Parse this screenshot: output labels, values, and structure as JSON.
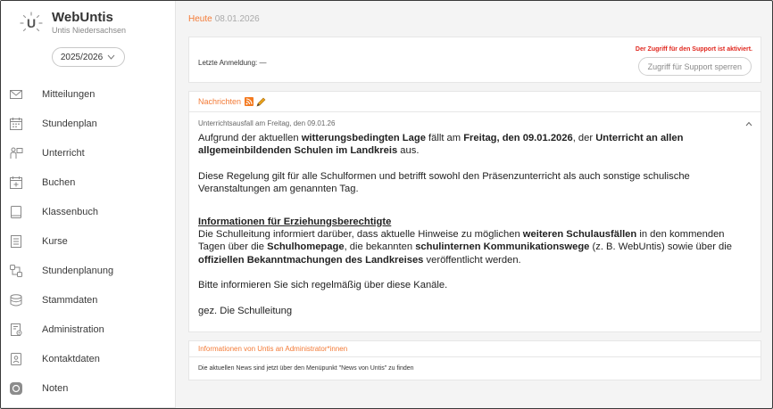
{
  "brand": {
    "title": "WebUntis",
    "subtitle": "Untis Niedersachsen"
  },
  "school_year": {
    "selected": "2025/2026"
  },
  "sidebar": {
    "items": [
      {
        "label": "Mitteilungen",
        "icon": "mail-icon"
      },
      {
        "label": "Stundenplan",
        "icon": "calendar-icon"
      },
      {
        "label": "Unterricht",
        "icon": "teacher-icon"
      },
      {
        "label": "Buchen",
        "icon": "calendar-plus-icon"
      },
      {
        "label": "Klassenbuch",
        "icon": "book-icon"
      },
      {
        "label": "Kurse",
        "icon": "list-icon"
      },
      {
        "label": "Stundenplanung",
        "icon": "planning-icon"
      },
      {
        "label": "Stammdaten",
        "icon": "database-icon"
      },
      {
        "label": "Administration",
        "icon": "admin-gear-icon"
      },
      {
        "label": "Kontaktdaten",
        "icon": "contact-icon"
      },
      {
        "label": "Noten",
        "icon": "grades-icon"
      }
    ]
  },
  "header": {
    "today_label": "Heute",
    "today_date": "08.01.2026"
  },
  "login": {
    "last_login": "Letzte Anmeldung: —",
    "support_status": "Der Zugriff für den Support ist aktiviert.",
    "support_button": "Zugriff für Support sperren"
  },
  "news": {
    "title": "Nachrichten",
    "subject": "Unterrichtsausfall am Freitag, den 09.01.26",
    "p1": {
      "t1": "Aufgrund der aktuellen ",
      "b1": "witterungsbedingten Lage",
      "t2": " fällt am ",
      "b2": "Freitag, den 09.01.2026",
      "t3": ", der ",
      "b3": "Unterricht an allen allgemeinbildenden Schulen im Landkreis",
      "t4": " aus."
    },
    "p2": "Diese Regelung gilt für alle Schulformen und betrifft sowohl den Präsenzunterricht als auch sonstige schulische Veranstaltungen am genannten Tag.",
    "p3_heading": "Informationen für Erziehungsberechtigte",
    "p3": {
      "t1": "Die Schulleitung informiert darüber, dass aktuelle Hinweise zu möglichen ",
      "b1": "weiteren Schulausfällen",
      "t2": " in den kommenden Tagen über die ",
      "b2": "Schulhomepage",
      "t3": ", die bekannten ",
      "b3": "schulinternen Kommunikationswege",
      "t4": " (z. B. WebUntis) sowie über die ",
      "b4": "offiziellen Bekanntmachungen des Landkreises",
      "t5": " veröffentlicht werden."
    },
    "p4": "Bitte informieren Sie sich regelmäßig über diese Kanäle.",
    "p5": "gez. Die Schulleitung"
  },
  "admin_news": {
    "title": "Informationen von Untis an Administrator*innen",
    "text": "Die aktuellen News sind jetzt über den Menüpunkt \"News von Untis\" zu finden"
  },
  "colors": {
    "accent": "#f37a36",
    "warning": "#e0271e",
    "rss": "#f47a20"
  }
}
